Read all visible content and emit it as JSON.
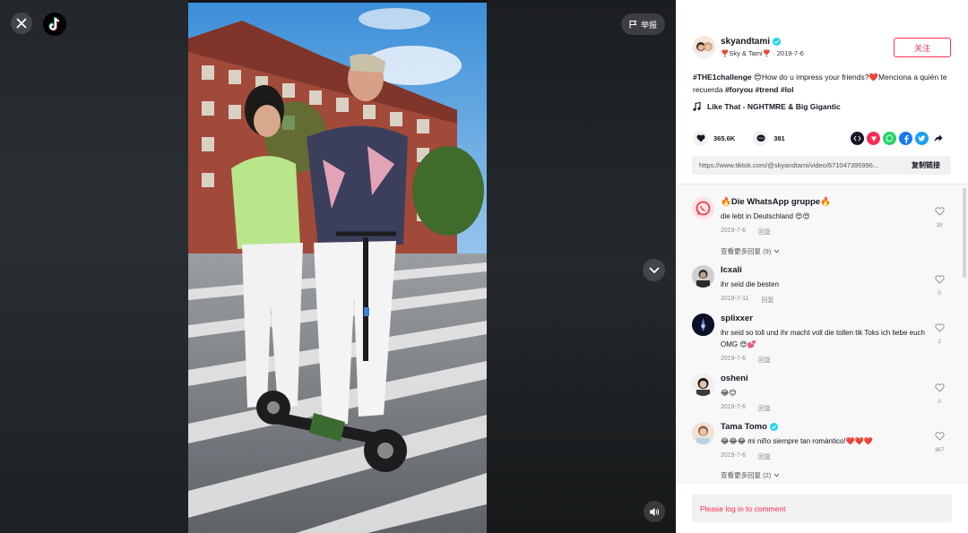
{
  "header": {
    "report_label": "举报"
  },
  "author": {
    "username": "skyandtami",
    "nickname": "❣️Sky & Tami❣️",
    "date": "2019-7-6",
    "follow_label": "关注"
  },
  "description": {
    "tag1": "#THE1challenge",
    "text1": "😍How do u impress your friends?❤️Menciona a quién te recuerda",
    "tag2": "#foryou",
    "tag3": "#trend",
    "tag4": "#lol"
  },
  "music": {
    "title": "Like That - NGHTMRE & Big Gigantic"
  },
  "stats": {
    "likes": "365.6K",
    "comments": "381"
  },
  "link": {
    "url": "https://www.tiktok.com/@skyandtami/video/671047395996...",
    "copy_label": "复制链接"
  },
  "comments": [
    {
      "name": "🔥Die WhatsApp gruppe🔥",
      "text": "die lebt in Deutschland 😍😍",
      "date": "2019-7-6",
      "reply": "回复",
      "likes": "18",
      "more": "查看更多回复 (9)",
      "verified": false
    },
    {
      "name": "Icxali",
      "text": "ihr seid die besten",
      "date": "2019-7-11",
      "reply": "回复",
      "likes": "0",
      "verified": false
    },
    {
      "name": "splixxer",
      "text": "ihr seid so toll und ihr macht voll die tollen tik Toks ich liebe euch OMG 😍💕",
      "date": "2019-7-6",
      "reply": "回复",
      "likes": "1",
      "verified": false
    },
    {
      "name": "osheni",
      "text": "😂😊",
      "date": "2019-7-6",
      "reply": "回复",
      "likes": "0",
      "verified": false
    },
    {
      "name": "Tama Tomo",
      "text": "😂😂😂 mi niño siempre tan romántico!❤️❤️❤️",
      "date": "2019-7-6",
      "reply": "回复",
      "likes": "367",
      "more": "查看更多回复 (2)",
      "verified": true
    }
  ],
  "login": {
    "prompt": "Please log in to comment"
  },
  "colors": {
    "accent": "#fe2c55",
    "verified": "#20d5ec",
    "panel_bg": "#f8f8f8"
  }
}
